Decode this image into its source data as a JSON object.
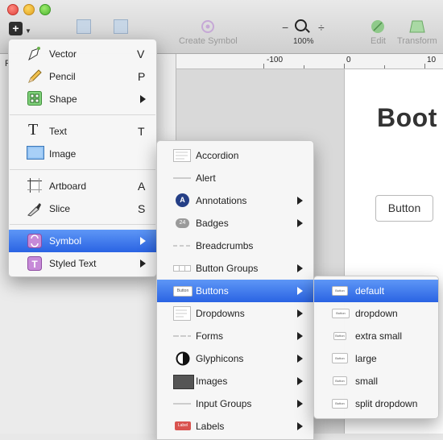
{
  "toolbar": {
    "items": [
      {
        "label": "Create Symbol"
      },
      {
        "label": "100%"
      },
      {
        "label": "Edit"
      },
      {
        "label": "Transform"
      }
    ],
    "zoom_minus": "−",
    "zoom_plus": "÷"
  },
  "ruler": {
    "ticks": [
      "-100",
      "0",
      "10"
    ]
  },
  "artboard": {
    "title": "Boot",
    "button_label": "Button"
  },
  "pane": {
    "partial_label": "P"
  },
  "insert_menu": {
    "items": [
      {
        "label": "Vector",
        "key": "V",
        "icon": "vector-pen-icon"
      },
      {
        "label": "Pencil",
        "key": "P",
        "icon": "pencil-icon"
      },
      {
        "label": "Shape",
        "key": "",
        "icon": "shape-icon",
        "submenu": true
      },
      {
        "label": "Text",
        "key": "T",
        "icon": "text-icon"
      },
      {
        "label": "Image",
        "key": "",
        "icon": "image-icon"
      },
      {
        "label": "Artboard",
        "key": "A",
        "icon": "artboard-icon"
      },
      {
        "label": "Slice",
        "key": "S",
        "icon": "slice-knife-icon"
      },
      {
        "label": "Symbol",
        "key": "",
        "icon": "symbol-icon",
        "submenu": true,
        "selected": true
      },
      {
        "label": "Styled Text",
        "key": "",
        "icon": "styled-text-icon",
        "submenu": true
      }
    ]
  },
  "symbol_menu": {
    "items": [
      {
        "label": "Accordion",
        "submenu": false
      },
      {
        "label": "Alert",
        "submenu": false
      },
      {
        "label": "Annotations",
        "submenu": true
      },
      {
        "label": "Badges",
        "submenu": true
      },
      {
        "label": "Breadcrumbs",
        "submenu": false
      },
      {
        "label": "Button Groups",
        "submenu": true
      },
      {
        "label": "Buttons",
        "submenu": true,
        "selected": true
      },
      {
        "label": "Dropdowns",
        "submenu": true
      },
      {
        "label": "Forms",
        "submenu": true
      },
      {
        "label": "Glyphicons",
        "submenu": true
      },
      {
        "label": "Images",
        "submenu": true
      },
      {
        "label": "Input Groups",
        "submenu": true
      },
      {
        "label": "Labels",
        "submenu": true
      }
    ],
    "badge_text": "24",
    "annotation_letter": "A",
    "label_chip": "Label",
    "button_chip": "Button"
  },
  "buttons_menu": {
    "items": [
      {
        "label": "default",
        "selected": true
      },
      {
        "label": "dropdown"
      },
      {
        "label": "extra small"
      },
      {
        "label": "large"
      },
      {
        "label": "small"
      },
      {
        "label": "split dropdown"
      }
    ],
    "thumb_text": "Button"
  },
  "colors": {
    "selection": "#2f6be6",
    "toolbar": "#d9d9d9"
  }
}
